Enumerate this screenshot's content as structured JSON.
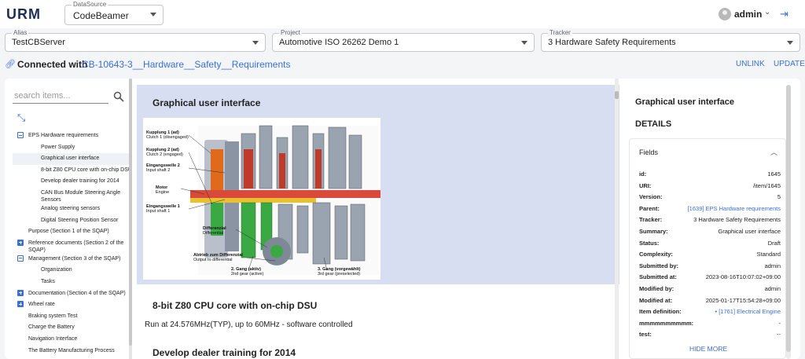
{
  "app": {
    "logo": "URM"
  },
  "header": {
    "datasource_label": "DataSource",
    "datasource_value": "CodeBeamer",
    "user": "admin"
  },
  "selectors": {
    "alias": {
      "label": "Alias",
      "value": "TestCBServer"
    },
    "project": {
      "label": "Project",
      "value": "Automotive ISO 26262 Demo 1"
    },
    "tracker": {
      "label": "Tracker",
      "value": "3 Hardware Safety Requirements"
    }
  },
  "connection": {
    "prefix": "Connected with",
    "id": "CB-10643-3__Hardware__Safety__Requirements",
    "unlink": "UNLINK",
    "update": "UPDATE"
  },
  "left": {
    "search_placeholder": "search items...",
    "tree": [
      {
        "label": "EPS Hardware requirements",
        "level": 0,
        "box": "minus"
      },
      {
        "label": "Power Supply",
        "level": 1
      },
      {
        "label": "Graphical user interface",
        "level": 1,
        "selected": true
      },
      {
        "label": "8-bit Z80 CPU core with on-chip DSU",
        "level": 1
      },
      {
        "label": "Develop dealer training for 2014",
        "level": 1
      },
      {
        "label": "CAN Bus Module Steering Angle",
        "label2": "Sensors",
        "level": 1
      },
      {
        "label": "Analog steering sensors",
        "level": 1
      },
      {
        "label": "Digital Steering Position Sensor",
        "level": 1
      },
      {
        "label": "Purpose (Section 1 of the SQAP)",
        "level": 0
      },
      {
        "label": "Reference documents (Section 2 of the",
        "label2": "SQAP)",
        "level": 0,
        "box": "plus"
      },
      {
        "label": "Management (Section 3 of the SQAP)",
        "level": 0,
        "box": "minus"
      },
      {
        "label": "Organization",
        "level": 1
      },
      {
        "label": "Tasks",
        "level": 1
      },
      {
        "label": "Documentation (Section 4 of the SQAP)",
        "level": 0,
        "box": "plus"
      },
      {
        "label": "Wheel rate",
        "level": 0,
        "box": "plus"
      },
      {
        "label": "Braking system Test",
        "level": 0
      },
      {
        "label": "Charge the Battery",
        "level": 0
      },
      {
        "label": "Navigation Interface",
        "level": 0
      },
      {
        "label": "The Battery Manufacturing Process",
        "level": 0
      }
    ]
  },
  "center": {
    "section1_title": "Graphical user interface",
    "diagram_labels": {
      "kupplung1": "Kupplung 1 (ad)",
      "clutch1": "Clutch 1 (disengaged)",
      "kupplung2": "Kupplung 2 (ad)",
      "clutch2": "Clutch 2 (engaged)",
      "eingang2": "Eingangswelle 2",
      "input2": "Input shaft 2",
      "motor": "Motor",
      "engine": "Engine",
      "eingang1": "Eingangswelle 1",
      "input1": "Input shaft 1",
      "differenzial": "Differenzial",
      "differential": "Differential",
      "abtrieb": "Abtrieb zum Differenzial",
      "output": "Output to differential",
      "gang2a": "2. Gang (aktiv)",
      "gear2a": "2nd gear (active)",
      "gang3": "3. Gang (vorgewählt)",
      "gear3": "3rd gear (preselected)"
    },
    "section2_title": "8-bit Z80 CPU core with on-chip DSU",
    "section2_text": "Run at 24.576MHz(TYP), up to 60MHz - software controlled",
    "section3_title": "Develop dealer training for 2014"
  },
  "right": {
    "title": "Graphical user interface",
    "details": "DETAILS",
    "fields_title": "Fields",
    "fields": [
      {
        "k": "id:",
        "v": "1645"
      },
      {
        "k": "URI:",
        "v": "/item/1645"
      },
      {
        "k": "Version:",
        "v": "5"
      },
      {
        "k": "Parent:",
        "v": "[1639] EPS Hardware requirements",
        "link": true
      },
      {
        "k": "Tracker:",
        "v": "3 Hardware Safety Requirements"
      },
      {
        "k": "Summary:",
        "v": "Graphical user interface"
      },
      {
        "k": "Status:",
        "v": "Draft"
      },
      {
        "k": "Complexity:",
        "v": "Standard"
      },
      {
        "k": "Submitted by:",
        "v": "admin"
      },
      {
        "k": "Submitted at:",
        "v": "2023-08-16T10:07:02+09:00"
      },
      {
        "k": "Modified by:",
        "v": "admin"
      },
      {
        "k": "Modified at:",
        "v": "2025-01-17T15:54:28+09:00"
      },
      {
        "k": "Item definition:",
        "v": "• [1761] Electrical Engine",
        "link": true
      },
      {
        "k": "mmmmmmmmmm:",
        "v": "-"
      },
      {
        "k": "test:",
        "v": "--"
      }
    ],
    "hide_more": "HIDE MORE"
  },
  "colors": {
    "accent": "#3a6fd8",
    "highlight": "#d7def2"
  }
}
